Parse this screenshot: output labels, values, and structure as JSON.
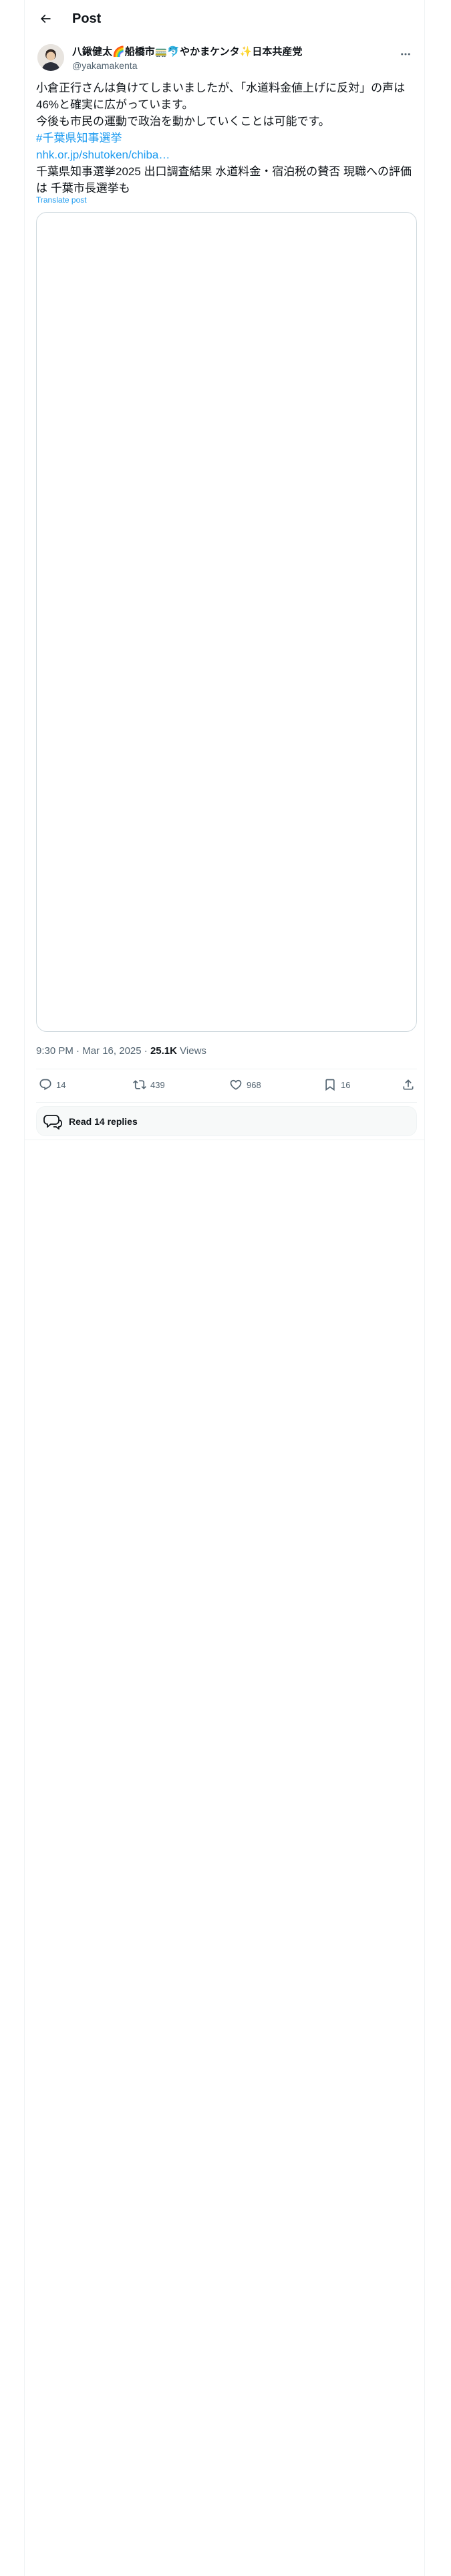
{
  "header": {
    "title": "Post"
  },
  "author": {
    "name_part1": "八鍬健太",
    "name_part2": "船橋市",
    "name_part3": "やかまケンタ",
    "name_part4": "日本共産党",
    "handle": "@yakamakenta"
  },
  "post": {
    "line1": "小倉正行さんは負けてしまいましたが、「水道料金値上げに反対」の声は46%と確実に広がっています。",
    "line2": "今後も市民の運動で政治を動かしていくことは可能です。",
    "hashtag": "#千葉県知事選挙",
    "link": "nhk.or.jp/shutoken/chiba…",
    "line3": "千葉県知事選挙2025 出口調査結果 水道料金・宿泊税の賛否 現職への評価は 千葉市長選挙も",
    "translate": "Translate post"
  },
  "meta": {
    "time": "9:30 PM",
    "dot1": "·",
    "date": "Mar 16, 2025",
    "dot2": "·",
    "views_count": "25.1K",
    "views_label": "Views"
  },
  "actions": {
    "replies": "14",
    "reposts": "439",
    "likes": "968",
    "bookmarks": "16"
  },
  "read_replies": "Read 14 replies",
  "colors": {
    "accent": "#1d9bf0",
    "text": "#0f1419",
    "muted": "#536471",
    "border": "#eff3f4"
  }
}
